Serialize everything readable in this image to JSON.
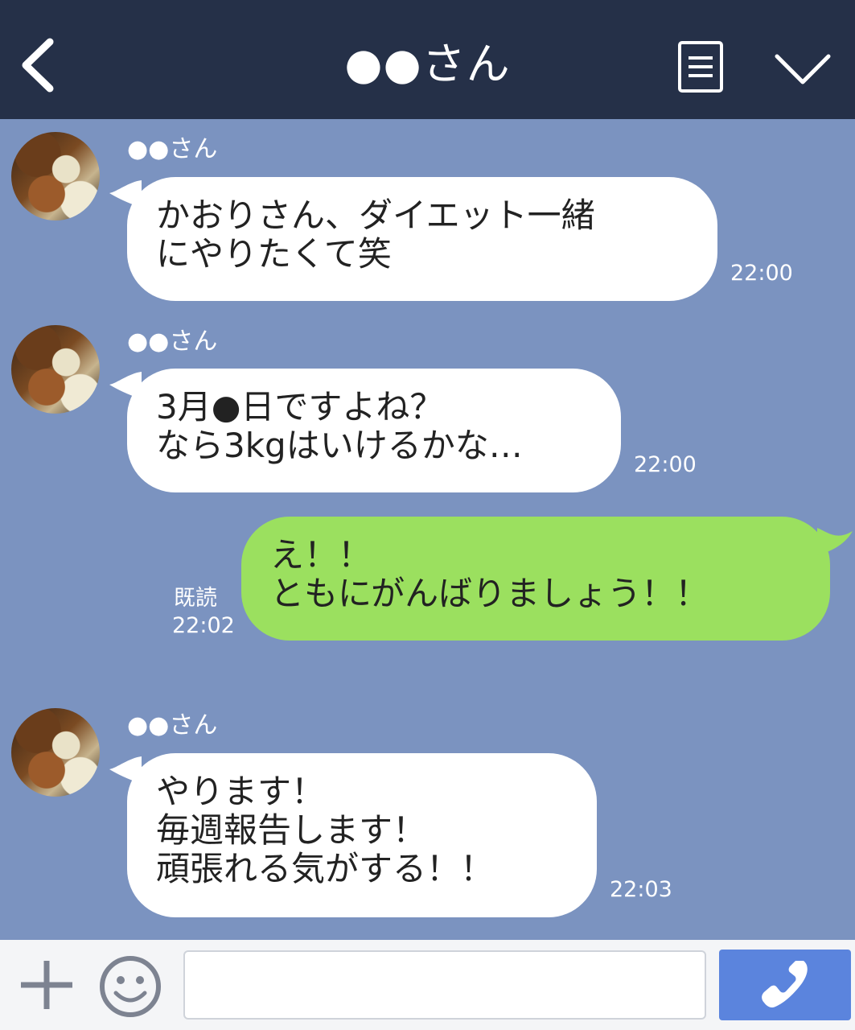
{
  "header": {
    "title": "●●さん"
  },
  "messages": [
    {
      "sender": "●●さん",
      "text": "かおりさん、ダイエット一緒\nにやりたくて笑",
      "time": "22:00"
    },
    {
      "sender": "●●さん",
      "text": "3月●日ですよね？\nなら3kgはいけるかな…",
      "time": "22:00"
    },
    {
      "text": "え！！\nともにがんばりましょう！！",
      "read": "既読",
      "time": "22:02"
    },
    {
      "sender": "●●さん",
      "text": "やります！\n毎週報告します！\n頑張れる気がする！！",
      "time": "22:03"
    }
  ],
  "input": {
    "placeholder": ""
  },
  "colors": {
    "header_bg": "#253048",
    "chat_bg": "#7b93c0",
    "incoming_bubble": "#ffffff",
    "outgoing_bubble": "#9be05f",
    "call_button": "#5b84dd"
  },
  "icons": [
    "back-icon",
    "menu-icon",
    "chevron-down-icon",
    "plus-icon",
    "emoji-icon",
    "phone-icon"
  ]
}
